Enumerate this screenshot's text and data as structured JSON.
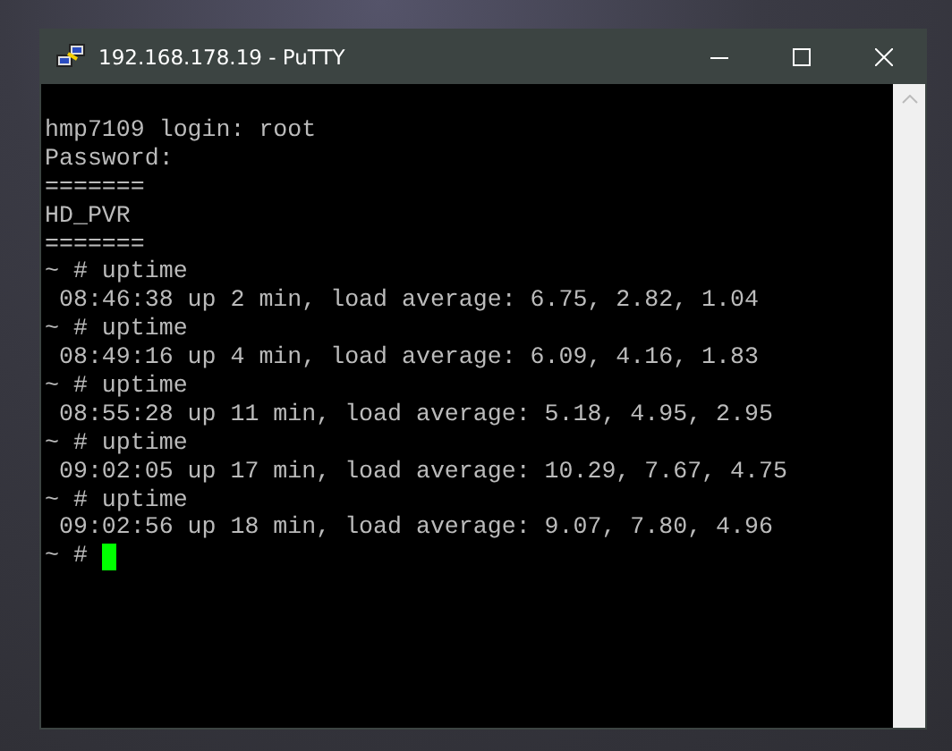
{
  "window": {
    "title": "192.168.178.19 - PuTTY"
  },
  "terminal": {
    "lines": [
      "hmp7109 login: root",
      "Password:",
      "=======",
      "HD_PVR",
      "=======",
      "~ # uptime",
      " 08:46:38 up 2 min, load average: 6.75, 2.82, 1.04",
      "~ # uptime",
      " 08:49:16 up 4 min, load average: 6.09, 4.16, 1.83",
      "~ # uptime",
      " 08:55:28 up 11 min, load average: 5.18, 4.95, 2.95",
      "~ # uptime",
      " 09:02:05 up 17 min, load average: 10.29, 7.67, 4.75",
      "~ # uptime",
      " 09:02:56 up 18 min, load average: 9.07, 7.80, 4.96"
    ],
    "prompt": "~ #"
  }
}
